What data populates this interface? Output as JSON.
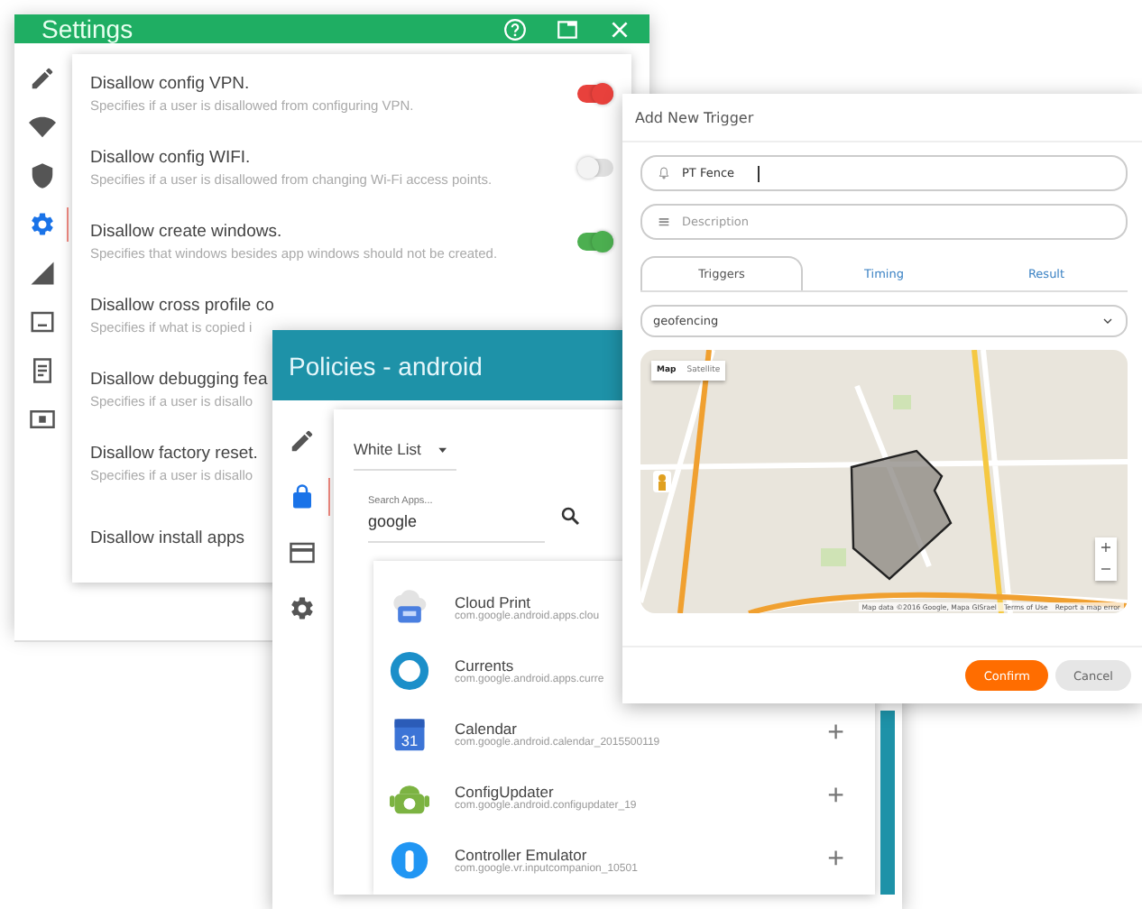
{
  "settings_window": {
    "title": "Settings",
    "sidebar": {
      "items": [
        {
          "selected": false
        },
        {
          "selected": false
        },
        {
          "selected": false
        },
        {
          "selected": true
        },
        {
          "selected": false
        },
        {
          "selected": false
        },
        {
          "selected": false
        },
        {
          "selected": false
        }
      ]
    },
    "rows": [
      {
        "title": "Disallow config VPN.",
        "description": "Specifies if a user is disallowed from configuring VPN.",
        "toggle": {
          "on": true,
          "color": "#e8413c"
        }
      },
      {
        "title": "Disallow config WIFI.",
        "description": "Specifies if a user is disallowed from changing Wi-Fi access points.",
        "toggle": {
          "on": false
        }
      },
      {
        "title": "Disallow create windows.",
        "description": "Specifies that windows besides app windows should not be created.",
        "toggle": {
          "on": true,
          "color": "#4caf50"
        }
      },
      {
        "title": "Disallow cross profile co",
        "description": "Specifies if what is copied i"
      },
      {
        "title": "Disallow debugging fea",
        "description": "Specifies if a user is disallo"
      },
      {
        "title": "Disallow factory reset.",
        "description": "Specifies if a user is disallo"
      },
      {
        "title": "Disallow install apps"
      }
    ]
  },
  "policies_window": {
    "title": "Policies - android",
    "sidebar": {
      "items": [
        {
          "selected": false
        },
        {
          "selected": true
        },
        {
          "selected": false
        },
        {
          "selected": false
        }
      ]
    },
    "list_type": "White List",
    "search": {
      "label": "Search Apps...",
      "value": "google"
    },
    "apps": [
      {
        "kind": "cloud",
        "name": "Cloud Print",
        "package": "com.google.android.apps.clou"
      },
      {
        "kind": "ring",
        "name": "Currents",
        "package": "com.google.android.apps.curre"
      },
      {
        "kind": "calendar",
        "name": "Calendar",
        "package": "com.google.android.calendar_2015500119",
        "icon_text": "31",
        "action": "+"
      },
      {
        "kind": "android",
        "name": "ConfigUpdater",
        "package": "com.google.android.configupdater_19",
        "action": "+"
      },
      {
        "kind": "remote",
        "name": "Controller Emulator",
        "package": "com.google.vr.inputcompanion_10501",
        "action": "+"
      }
    ]
  },
  "trigger_window": {
    "title": "Add New Trigger",
    "name_field": {
      "value": "PT Fence"
    },
    "description_field": {
      "placeholder": "Description"
    },
    "tabs": [
      {
        "label": "Triggers",
        "selected": true
      },
      {
        "label": "Timing",
        "selected": false
      },
      {
        "label": "Result",
        "selected": false
      }
    ],
    "trigger_type": "geofencing",
    "map": {
      "map_type_buttons": [
        {
          "label": "Map",
          "selected": true
        },
        {
          "label": "Satellite",
          "selected": false
        }
      ],
      "zoom_in": "+",
      "zoom_out": "−",
      "attribution": "Map data ©2016 Google, Mapa GISrael",
      "terms": "Terms of Use",
      "report": "Report a map error"
    },
    "buttons": [
      {
        "label": "Confirm",
        "kind": "primary"
      },
      {
        "label": "Cancel",
        "kind": "secondary"
      }
    ]
  }
}
